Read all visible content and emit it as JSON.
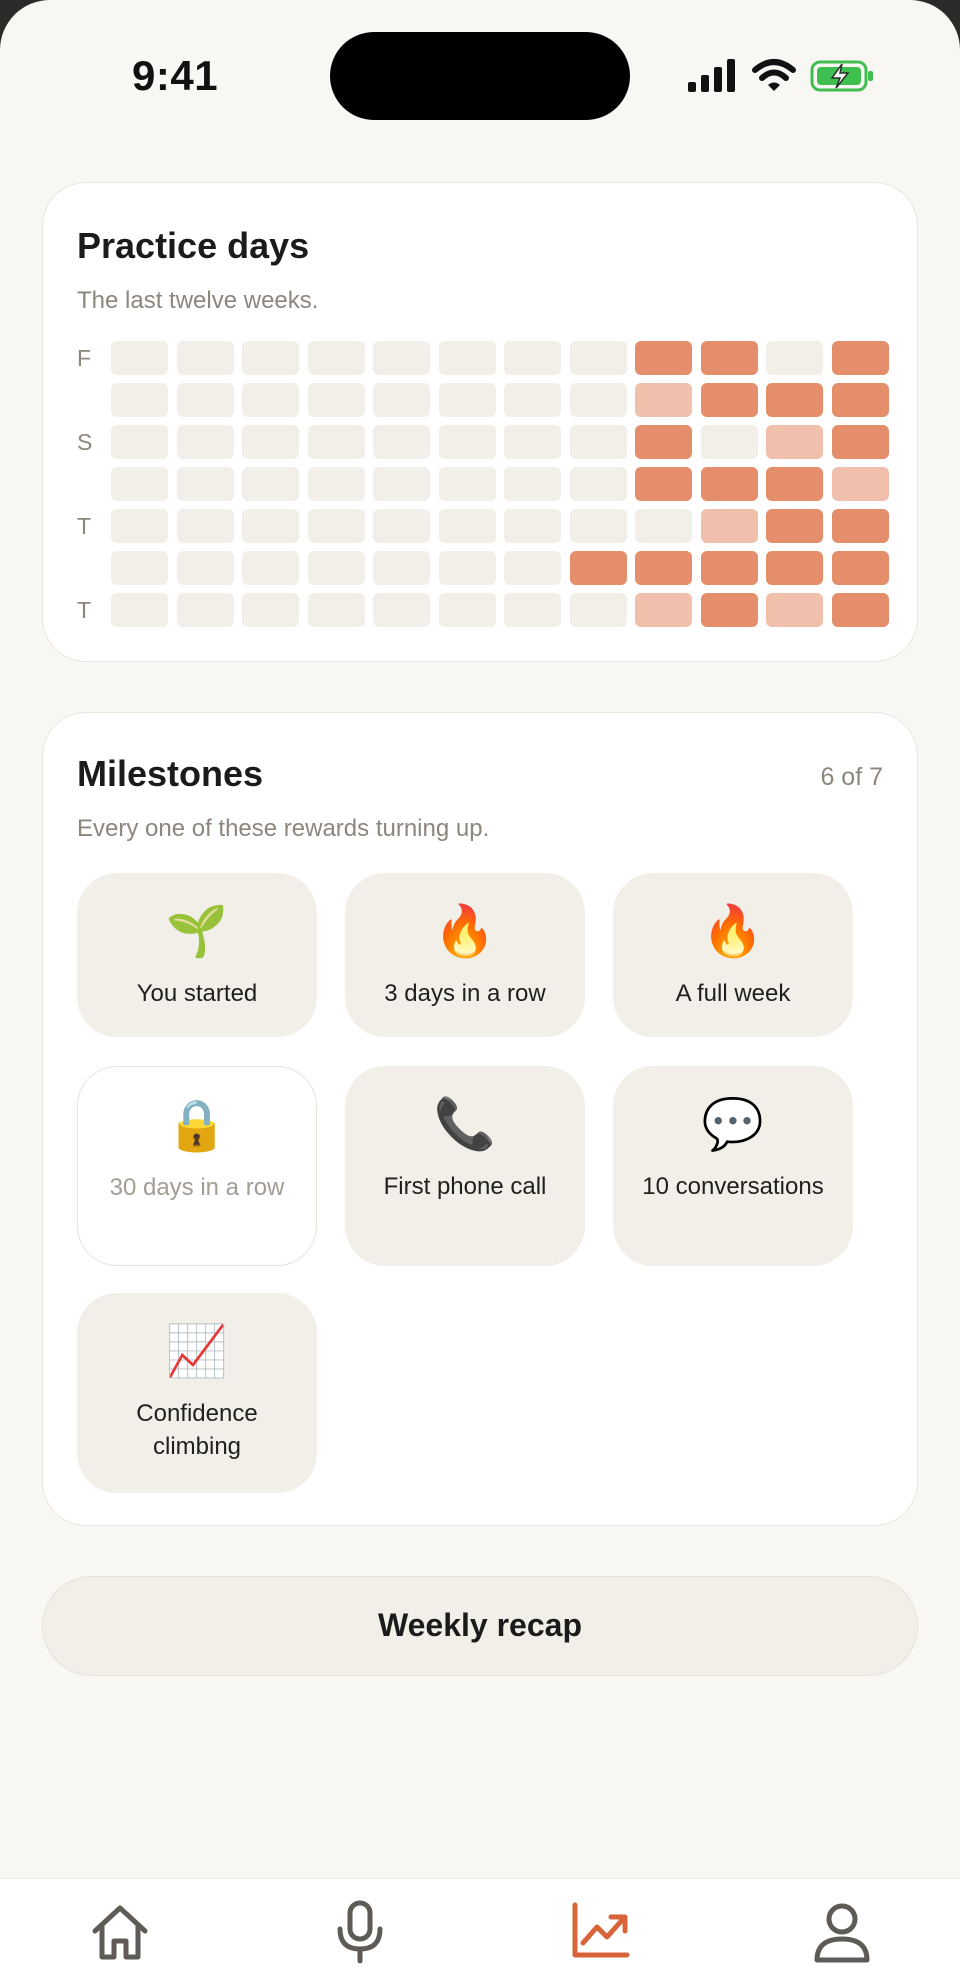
{
  "status_bar": {
    "time": "9:41"
  },
  "practice": {
    "title": "Practice days",
    "subtitle": "The last twelve weeks.",
    "row_labels": [
      "F",
      "",
      "S",
      "",
      "T",
      "",
      "T"
    ],
    "levels": [
      [
        0,
        0,
        0,
        0,
        0,
        0,
        0,
        0,
        2,
        2,
        0,
        2
      ],
      [
        0,
        0,
        0,
        0,
        0,
        0,
        0,
        0,
        1,
        2,
        2,
        2
      ],
      [
        0,
        0,
        0,
        0,
        0,
        0,
        0,
        0,
        2,
        0,
        1,
        2
      ],
      [
        0,
        0,
        0,
        0,
        0,
        0,
        0,
        0,
        2,
        2,
        2,
        1
      ],
      [
        0,
        0,
        0,
        0,
        0,
        0,
        0,
        0,
        0,
        1,
        2,
        2
      ],
      [
        0,
        0,
        0,
        0,
        0,
        0,
        0,
        2,
        2,
        2,
        2,
        2
      ],
      [
        0,
        0,
        0,
        0,
        0,
        0,
        0,
        0,
        1,
        2,
        1,
        2
      ]
    ],
    "colors": {
      "0": "#f2efe9",
      "1": "#f1c0ad",
      "2": "#e58e6c"
    }
  },
  "milestones": {
    "title": "Milestones",
    "count": "6 of 7",
    "subtitle": "Every one of these rewards turning up.",
    "items": [
      {
        "icon": "seedling-icon",
        "emoji": "🌱",
        "label": "You started",
        "locked": false
      },
      {
        "icon": "fire-icon",
        "emoji": "🔥",
        "label": "3 days in a row",
        "locked": false
      },
      {
        "icon": "fire-icon",
        "emoji": "🔥",
        "label": "A full week",
        "locked": false
      },
      {
        "icon": "lock-icon",
        "emoji": "🔒",
        "label": "30 days in a row",
        "locked": true
      },
      {
        "icon": "phone-icon",
        "emoji": "📞",
        "label": "First phone call",
        "locked": false
      },
      {
        "icon": "speech-bubble-icon",
        "emoji": "💬",
        "label": "10 conversations",
        "locked": false
      },
      {
        "icon": "chart-increasing-icon",
        "emoji": "📈",
        "label": "Confidence climbing",
        "locked": false
      }
    ]
  },
  "recap_button": {
    "label": "Weekly recap"
  },
  "tabbar": {
    "active": "progress",
    "accent": "#d9643a",
    "inactive": "#5e5a55",
    "items": [
      "home-icon",
      "microphone-icon",
      "progress-icon",
      "profile-icon"
    ]
  }
}
